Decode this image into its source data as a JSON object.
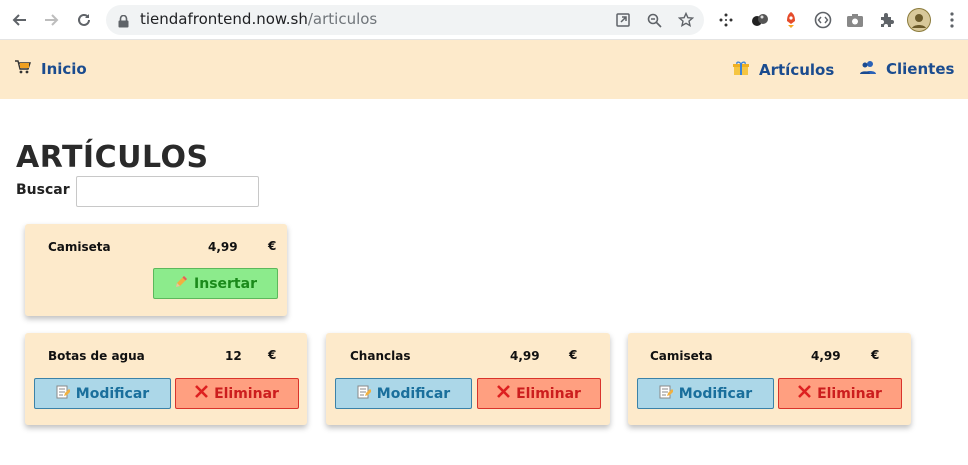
{
  "browser": {
    "url_domain": "tiendafrontend.now.sh",
    "url_path": "/articulos",
    "icons": [
      "back-icon",
      "forward-icon",
      "reload-icon",
      "lock-icon",
      "open-in-app-icon",
      "zoom-icon",
      "star-icon",
      "extension-dots-icon",
      "extension-balls-icon",
      "extension-rocket-icon",
      "extension-code-icon",
      "camera-icon",
      "puzzle-icon",
      "profile-avatar-icon",
      "menu-dots-icon"
    ]
  },
  "navbar": {
    "home_label": "Inicio",
    "articles_label": "Artículos",
    "clients_label": "Clientes"
  },
  "page": {
    "title": "ARTÍCULOS",
    "search_label": "Buscar",
    "search_value": ""
  },
  "new_article": {
    "name": "Camiseta",
    "price": "4,99",
    "currency": "€",
    "insert_label": "Insertar"
  },
  "articles": [
    {
      "name": "Botas de agua",
      "price": "12",
      "currency": "€",
      "modify_label": "Modificar",
      "delete_label": "Eliminar"
    },
    {
      "name": "Chanclas",
      "price": "4,99",
      "currency": "€",
      "modify_label": "Modificar",
      "delete_label": "Eliminar"
    },
    {
      "name": "Camiseta",
      "price": "4,99",
      "currency": "€",
      "modify_label": "Modificar",
      "delete_label": "Eliminar"
    }
  ],
  "colors": {
    "navbar_bg": "#fdeacb",
    "nav_link": "#1b4c8f",
    "insert_bg": "#8ceb8c",
    "modify_bg": "#acd7e8",
    "delete_bg": "#ff9f80"
  }
}
